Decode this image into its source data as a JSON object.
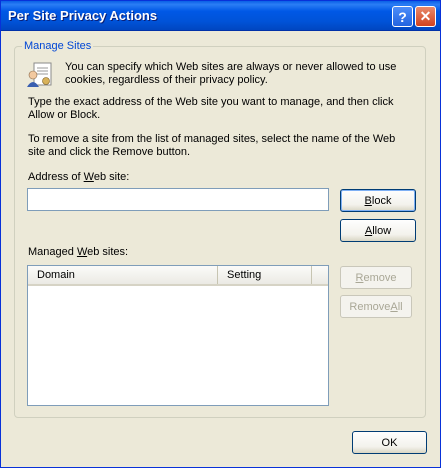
{
  "window": {
    "title": "Per Site Privacy Actions",
    "help_glyph": "?",
    "close_glyph": "✕"
  },
  "group": {
    "label": "Manage Sites",
    "intro_text": "You can specify which Web sites are always or never allowed to use cookies, regardless of their privacy policy.",
    "type_text": "Type the exact address of the Web site you want to manage, and then click Allow or Block.",
    "remove_text": "To remove a site from the list of managed sites, select the name of the Web site and click the Remove button.",
    "address_label_pre": "Address of ",
    "address_label_u": "W",
    "address_label_post": "eb site:",
    "address_value": "",
    "managed_label_pre": "Managed ",
    "managed_label_u": "W",
    "managed_label_post": "eb sites:"
  },
  "buttons": {
    "block_u": "B",
    "block_rest": "lock",
    "allow_u": "A",
    "allow_rest": "llow",
    "remove_u": "R",
    "remove_rest": "emove",
    "remove_all_pre": "Remove ",
    "remove_all_u": "A",
    "remove_all_rest": "ll",
    "ok": "OK"
  },
  "list": {
    "columns": [
      "Domain",
      "Setting"
    ],
    "rows": []
  },
  "icons": {
    "info": "privacy-info-icon"
  }
}
